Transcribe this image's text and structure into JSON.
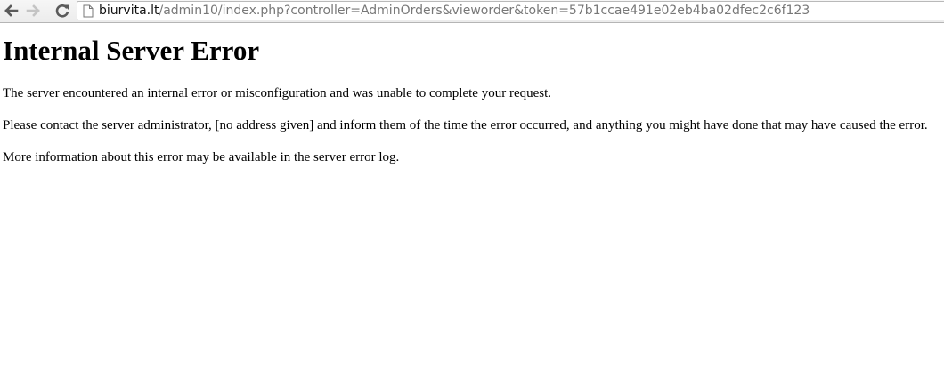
{
  "browser": {
    "url_host": "biurvita.lt",
    "url_path": "/admin10/index.php?controller=AdminOrders&vieworder&token=57b1ccae491e02eb4ba02dfec2c6f123",
    "icons": {
      "back": "back-arrow-icon",
      "forward": "forward-arrow-icon",
      "reload": "reload-icon",
      "page": "page-icon"
    }
  },
  "page": {
    "title": "Internal Server Error",
    "paragraphs": [
      "The server encountered an internal error or misconfiguration and was unable to complete your request.",
      "Please contact the server administrator, [no address given] and inform them of the time the error occurred, and anything you might have done that may have caused the error.",
      "More information about this error may be available in the server error log."
    ]
  }
}
